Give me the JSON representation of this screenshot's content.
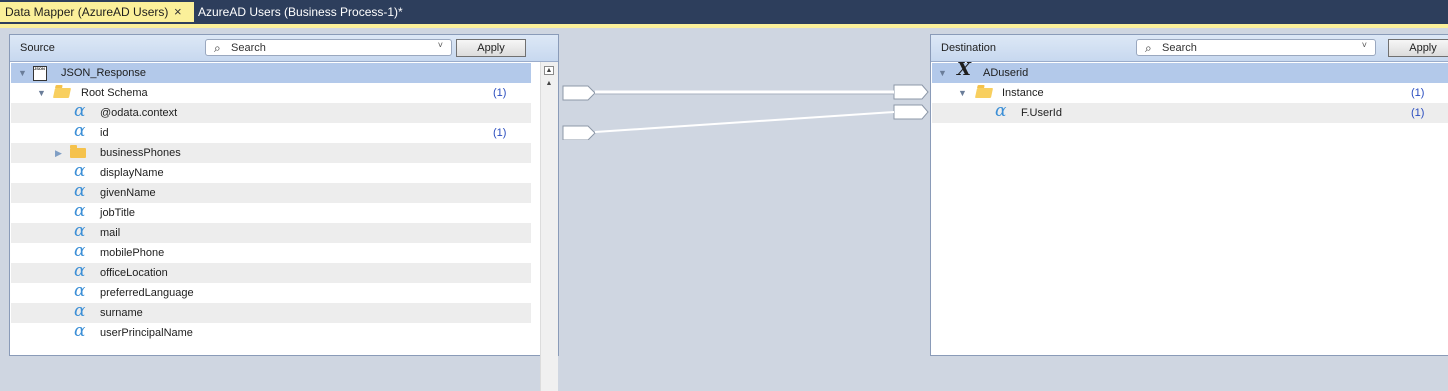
{
  "tabs": {
    "active": {
      "label": "Data Mapper (AzureAD Users)",
      "close": "×"
    },
    "inactive": {
      "label": "AzureAD Users (Business Process-1)*"
    }
  },
  "source": {
    "title": "Source",
    "search_placeholder": "Search",
    "apply_label": "Apply",
    "tree": [
      {
        "label": "JSON_Response",
        "icon": "json-file-icon",
        "selected": true
      },
      {
        "label": "Root Schema",
        "icon": "open-folder-icon",
        "count": "(1)"
      },
      {
        "label": "@odata.context",
        "icon": "alpha-icon"
      },
      {
        "label": "id",
        "icon": "alpha-icon",
        "count": "(1)"
      },
      {
        "label": "businessPhones",
        "icon": "folder-icon"
      },
      {
        "label": "displayName",
        "icon": "alpha-icon"
      },
      {
        "label": "givenName",
        "icon": "alpha-icon"
      },
      {
        "label": "jobTitle",
        "icon": "alpha-icon"
      },
      {
        "label": "mail",
        "icon": "alpha-icon"
      },
      {
        "label": "mobilePhone",
        "icon": "alpha-icon"
      },
      {
        "label": "officeLocation",
        "icon": "alpha-icon"
      },
      {
        "label": "preferredLanguage",
        "icon": "alpha-icon"
      },
      {
        "label": "surname",
        "icon": "alpha-icon"
      },
      {
        "label": "userPrincipalName",
        "icon": "alpha-icon"
      }
    ]
  },
  "destination": {
    "title": "Destination",
    "search_placeholder": "Search",
    "apply_label": "Apply",
    "tree": [
      {
        "label": "ADuserid",
        "icon": "variable-x-icon",
        "selected": true
      },
      {
        "label": "Instance",
        "icon": "open-folder-icon",
        "count": "(1)"
      },
      {
        "label": "F.UserId",
        "icon": "alpha-icon",
        "count": "(1)"
      }
    ]
  },
  "glyphs": {
    "alpha": "α",
    "x": "X",
    "expanded": "▼",
    "collapsed": "▶",
    "magnifier": "⌕",
    "dropdown": "˅"
  }
}
